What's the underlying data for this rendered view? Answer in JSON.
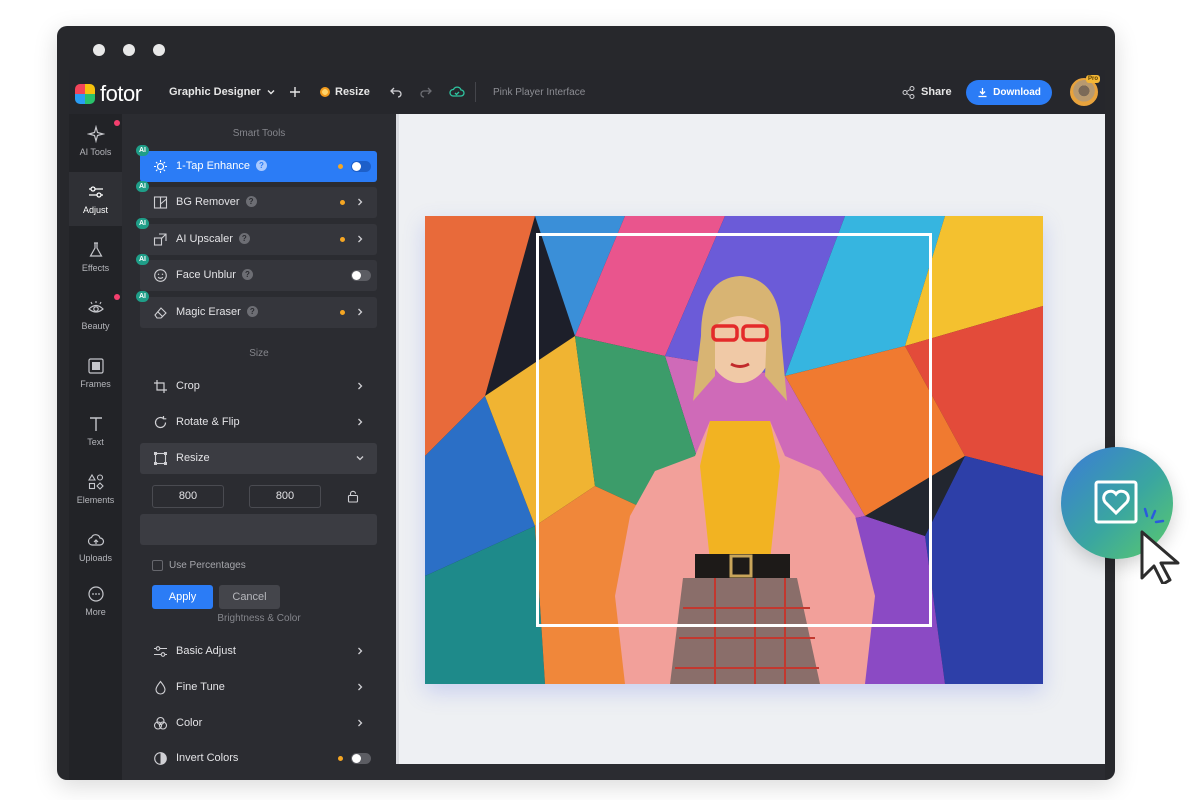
{
  "window": {
    "controls": [
      "close",
      "minimize",
      "maximize"
    ]
  },
  "topbar": {
    "logo_text": "fotor",
    "mode_label": "Graphic Designer",
    "resize_label": "Resize",
    "project_title": "Pink Player Interface",
    "share_label": "Share",
    "download_label": "Download",
    "pro_badge": "Pro"
  },
  "rail": {
    "items": [
      {
        "label": "AI Tools",
        "icon": "sparkle-icon"
      },
      {
        "label": "Adjust",
        "icon": "sliders-icon"
      },
      {
        "label": "Effects",
        "icon": "flask-icon"
      },
      {
        "label": "Beauty",
        "icon": "eye-icon"
      },
      {
        "label": "Frames",
        "icon": "frame-icon"
      },
      {
        "label": "Text",
        "icon": "text-icon"
      },
      {
        "label": "Elements",
        "icon": "shapes-icon"
      },
      {
        "label": "Uploads",
        "icon": "cloud-upload-icon"
      },
      {
        "label": "More",
        "icon": "more-icon"
      }
    ],
    "active": "Adjust"
  },
  "panel": {
    "smart_tools_title": "Smart Tools",
    "ai_badge": "AI",
    "smart_tools": [
      {
        "label": "1-Tap Enhance",
        "icon": "enhance-icon"
      },
      {
        "label": "BG Remover",
        "icon": "bg-remover-icon"
      },
      {
        "label": "AI Upscaler",
        "icon": "upscaler-icon"
      },
      {
        "label": "Face Unblur",
        "icon": "face-icon"
      },
      {
        "label": "Magic Eraser",
        "icon": "eraser-icon"
      }
    ],
    "size_title": "Size",
    "size_tools": [
      {
        "label": "Crop",
        "icon": "crop-icon"
      },
      {
        "label": "Rotate & Flip",
        "icon": "rotate-icon"
      },
      {
        "label": "Resize",
        "icon": "resize-icon"
      }
    ],
    "resize": {
      "width": "800",
      "height": "800",
      "times": "×",
      "use_percentages": "Use Percentages",
      "apply_label": "Apply",
      "cancel_label": "Cancel"
    },
    "brightness_title": "Brightness & Color",
    "brightness_tools": [
      {
        "label": "Basic Adjust",
        "icon": "basic-adjust-icon"
      },
      {
        "label": "Fine Tune",
        "icon": "droplet-icon"
      },
      {
        "label": "Color",
        "icon": "color-icon"
      },
      {
        "label": "Invert Colors",
        "icon": "invert-icon"
      }
    ]
  },
  "colors": {
    "accent": "#2b7cf6",
    "ai_badge": "#1f9e88",
    "notification": "#f43f6e",
    "premium_dot": "#f5a623"
  }
}
